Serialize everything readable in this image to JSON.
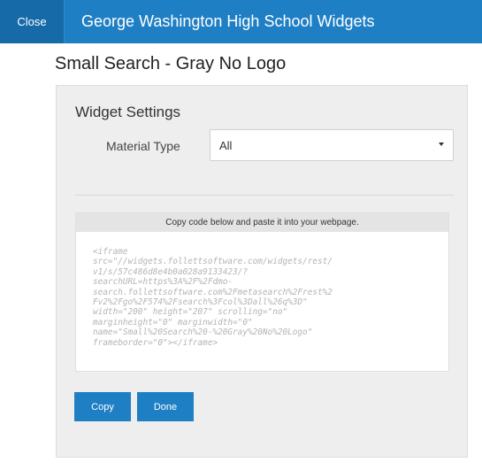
{
  "header": {
    "close_label": "Close",
    "title": "George Washington High School Widgets"
  },
  "dialog": {
    "title": "Small Search - Gray No Logo",
    "section_title": "Widget Settings",
    "material_type": {
      "label": "Material Type",
      "value": "All"
    },
    "code": {
      "instructions": "Copy code below and paste it into your webpage.",
      "snippet": "<iframe\nsrc=\"//widgets.follettsoftware.com/widgets/rest/\nv1/s/57c486d8e4b0a028a9133423/?\nsearchURL=https%3A%2F%2Fdmo-\nsearch.follettsoftware.com%2Fmetasearch%2Frest%2\nFv2%2Fgo%2F574%2Fsearch%3Fcol%3Dall%26q%3D\"\nwidth=\"200\" height=\"207\" scrolling=\"no\"\nmarginheight=\"0\" marginwidth=\"0\"\nname=\"Small%20Search%20-%20Gray%20No%20Logo\"\nframeborder=\"0\"></iframe>"
    },
    "copy_label": "Copy",
    "done_label": "Done"
  },
  "colors": {
    "primary": "#1f7fc4",
    "panel_bg": "#eeeeee"
  }
}
